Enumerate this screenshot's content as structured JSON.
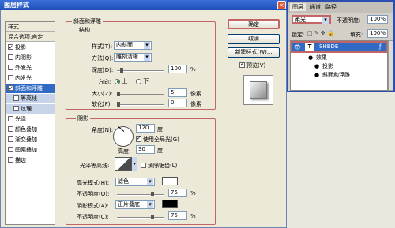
{
  "dialog": {
    "title": "图层样式",
    "close": "×",
    "left_items": [
      {
        "label": "样式",
        "kind": "head"
      },
      {
        "label": "混合选项:自定",
        "kind": "head"
      },
      {
        "label": "投影",
        "checked": true
      },
      {
        "label": "内阴影",
        "checked": false
      },
      {
        "label": "外发光",
        "checked": false
      },
      {
        "label": "内发光",
        "checked": false
      },
      {
        "label": "斜面和浮雕",
        "checked": true,
        "selected": true
      },
      {
        "label": "等高线",
        "checked": false,
        "sub": true
      },
      {
        "label": "纹理",
        "checked": false,
        "sub": true
      },
      {
        "label": "光泽",
        "checked": false
      },
      {
        "label": "颜色叠加",
        "checked": false
      },
      {
        "label": "渐变叠加",
        "checked": false
      },
      {
        "label": "图案叠加",
        "checked": false
      },
      {
        "label": "描边",
        "checked": false
      }
    ],
    "bevel": {
      "group_title": "斜面和浮雕",
      "struct_title": "结构",
      "style_label": "样式(T):",
      "style_value": "内斜面",
      "method_label": "方法(Q):",
      "method_value": "雕刻清晰",
      "depth_label": "深度(D):",
      "depth_value": "100",
      "depth_pct": 0.1,
      "depth_unit": "%",
      "direction_label": "方向:",
      "up_label": "上",
      "down_label": "下",
      "size_label": "大小(Z):",
      "size_value": "5",
      "size_pct": 0.02,
      "size_unit": "像素",
      "soften_label": "软化(F):",
      "soften_value": "0",
      "soften_pct": 0.0,
      "soften_unit": "像素"
    },
    "shading": {
      "group_title": "阴影",
      "angle_label": "角度(N):",
      "angle_value": "120",
      "angle_unit": "度",
      "global_light_label": "使用全局光(G)",
      "altitude_label": "高度:",
      "altitude_value": "30",
      "altitude_unit": "度",
      "gloss_label": "光泽等高线:",
      "antialias_label": "消除锯齿(L)",
      "highlight_label": "高光模式(H):",
      "highlight_value": "滤色",
      "highlight_color": "#ffffff",
      "hl_opacity_label": "不透明度(O):",
      "hl_opacity_value": "75",
      "hl_opacity_pct": 0.75,
      "shadow_label": "阴影模式(A):",
      "shadow_value": "正片叠底",
      "shadow_color": "#000000",
      "sh_opacity_label": "不透明度(C):",
      "sh_opacity_value": "75",
      "sh_opacity_pct": 0.75,
      "pct": "%"
    },
    "buttons": {
      "ok": "确定",
      "cancel": "取消",
      "new_style": "新建样式(W)...",
      "preview": "预览(V)"
    }
  },
  "layers_panel": {
    "tabs": [
      "图层",
      "通道",
      "路径"
    ],
    "blend_mode": "柔光",
    "opacity_label": "不透明度:",
    "opacity_value": "100%",
    "lock_label": "锁定:",
    "fill_label": "填充:",
    "fill_value": "100%",
    "layer_name": "SHBDE",
    "effects_label": "效果",
    "effect_1": "投影",
    "effect_2": "斜面和浮雕",
    "layer_icon": "T"
  }
}
